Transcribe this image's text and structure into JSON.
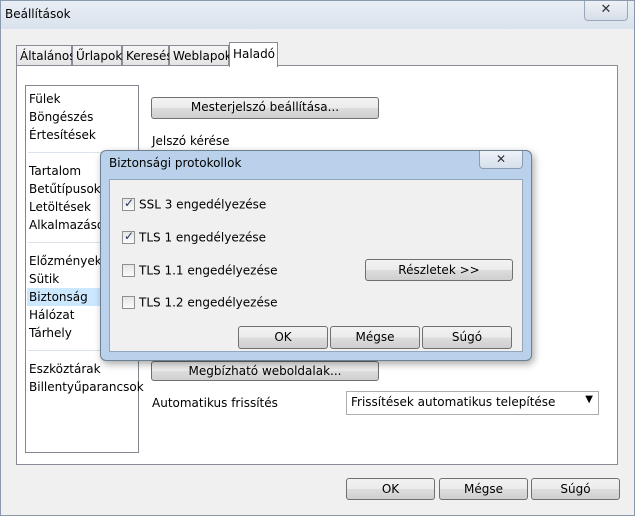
{
  "window": {
    "title": "Beállítások",
    "close_label": "✕"
  },
  "tabs": [
    {
      "label": "Általános"
    },
    {
      "label": "Űrlapok"
    },
    {
      "label": "Keresés"
    },
    {
      "label": "Weblapok"
    },
    {
      "label": "Haladó"
    }
  ],
  "sidebar": {
    "groups": [
      [
        "Fülek",
        "Böngészés",
        "Értesítések"
      ],
      [
        "Tartalom",
        "Betűtípusok",
        "Letöltések",
        "Alkalmazások"
      ],
      [
        "Előzmények",
        "Sütik",
        "Biztonság",
        "Hálózat",
        "Tárhely"
      ],
      [
        "Eszköztárak",
        "Billentyűparancsok"
      ]
    ],
    "selected": "Biztonság"
  },
  "security": {
    "master_password_button": "Mesterjelszó beállítása...",
    "password_prompt_label": "Jelszó kérése",
    "trusted_sites_button": "Megbízható weboldalak...",
    "auto_update_label": "Automatikus frissítés",
    "auto_update_value": "Frissítések automatikus telepítése"
  },
  "dialog": {
    "title": "Biztonsági protokollok",
    "close_label": "✕",
    "protocols": [
      {
        "label": "SSL 3 engedélyezése",
        "checked": true
      },
      {
        "label": "TLS 1 engedélyezése",
        "checked": true
      },
      {
        "label": "TLS 1.1 engedélyezése",
        "checked": false
      },
      {
        "label": "TLS 1.2 engedélyezése",
        "checked": false
      }
    ],
    "details_button": "Részletek >>",
    "ok": "OK",
    "cancel": "Mégse",
    "help": "Súgó"
  },
  "footer": {
    "ok": "OK",
    "cancel": "Mégse",
    "help": "Súgó"
  }
}
